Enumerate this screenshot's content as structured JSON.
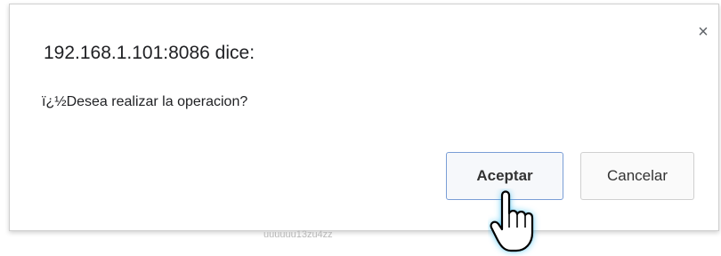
{
  "dialog": {
    "title": "192.168.1.101:8086 dice:",
    "message": "ï¿½Desea realizar la operacion?",
    "close_glyph": "×",
    "accept_label": "Aceptar",
    "cancel_label": "Cancelar"
  },
  "background": {
    "partial_text": "uuuuuu13zu4zz"
  },
  "cursor": {
    "icon": "hand-pointer-icon",
    "highlight_color": "#2ab7ef"
  }
}
